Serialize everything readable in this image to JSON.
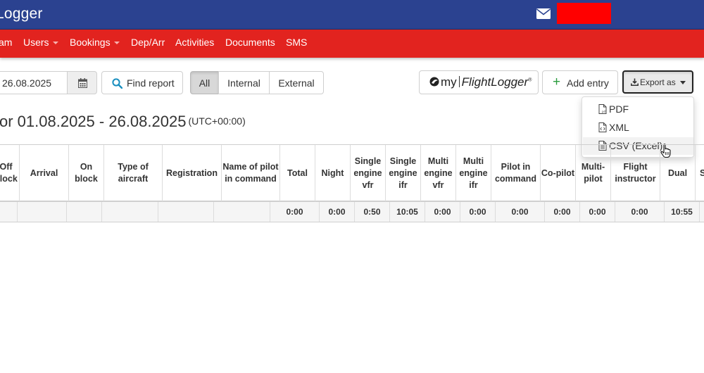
{
  "header": {
    "app_title": "Logger",
    "mail_icon": "envelope-icon",
    "user_color": "#ff0000"
  },
  "nav": {
    "items": [
      {
        "label": "am"
      },
      {
        "label": "Users",
        "dropdown": true
      },
      {
        "label": "Bookings",
        "dropdown": true
      },
      {
        "label": "Dep/Arr"
      },
      {
        "label": "Activities"
      },
      {
        "label": "Documents"
      },
      {
        "label": "SMS"
      }
    ]
  },
  "toolbar": {
    "date_to": "26.08.2025",
    "find_report": "Find report",
    "filter": {
      "all": "All",
      "internal": "Internal",
      "external": "External",
      "selected": "All"
    },
    "myflightlogger": {
      "my": "my",
      "brand": "FlightLogger",
      "reg": "®"
    },
    "add_entry": "Add entry",
    "export_as": "Export as"
  },
  "export_menu": {
    "items": [
      {
        "label": "PDF",
        "icon": "pdf-file-icon"
      },
      {
        "label": "XML",
        "icon": "code-file-icon"
      },
      {
        "label": "CSV (Excel)",
        "icon": "text-file-icon",
        "hover": true
      }
    ]
  },
  "report": {
    "title": "or 01.08.2025 - 26.08.2025",
    "timezone": "(UTC+00:00)"
  },
  "table": {
    "headers": [
      "Off block",
      "Arrival",
      "On block",
      "Type of aircraft",
      "Registration",
      "Name of pilot in command",
      "Total",
      "Night",
      "Single engine vfr",
      "Single engine ifr",
      "Multi engine vfr",
      "Multi engine ifr",
      "Pilot in command",
      "Co-pilot",
      "Multi-pilot",
      "Flight instructor",
      "Dual",
      "S"
    ],
    "totals": [
      "",
      "",
      "",
      "",
      "",
      "",
      "0:00",
      "0:00",
      "0:50",
      "10:05",
      "0:00",
      "0:00",
      "0:00",
      "0:00",
      "0:00",
      "0:00",
      "10:55",
      ""
    ]
  },
  "colors": {
    "topbar": "#2b4290",
    "navbar": "#e2231f",
    "add_icon": "#2a9c3e"
  }
}
